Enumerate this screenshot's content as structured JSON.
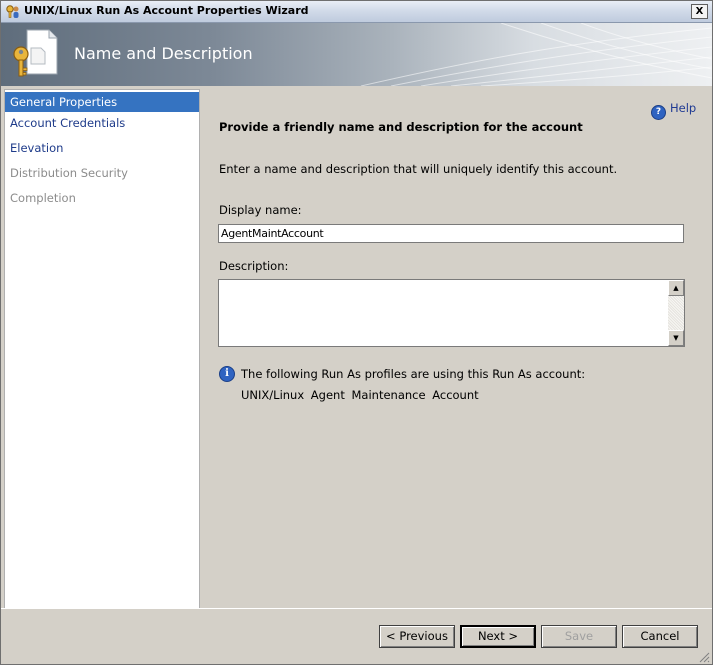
{
  "window": {
    "title": "UNIX/Linux Run As Account Properties Wizard",
    "close_label": "X"
  },
  "banner": {
    "title": "Name and Description"
  },
  "sidebar": {
    "items": [
      {
        "label": "General Properties",
        "state": "selected"
      },
      {
        "label": "Account Credentials",
        "state": "enabled"
      },
      {
        "label": "Elevation",
        "state": "enabled"
      },
      {
        "label": "Distribution Security",
        "state": "disabled"
      },
      {
        "label": "Completion",
        "state": "disabled"
      }
    ]
  },
  "main": {
    "help_label": "Help",
    "heading": "Provide a friendly name and description for the account",
    "intro": "Enter a name and description that will uniquely identify this account.",
    "display_name_label": "Display name:",
    "display_name_value": "AgentMaintAccount",
    "description_label": "Description:",
    "description_value": "",
    "info_text": "The following Run As profiles are using this Run As account:",
    "profile_name": "UNIX/Linux Agent Maintenance Account"
  },
  "footer": {
    "previous_label": "< Previous",
    "next_label": "Next >",
    "save_label": "Save",
    "cancel_label": "Cancel"
  },
  "icons": {
    "title": "key-account-icon",
    "banner": "key-document-icon",
    "help": "help-icon",
    "info": "info-icon"
  }
}
